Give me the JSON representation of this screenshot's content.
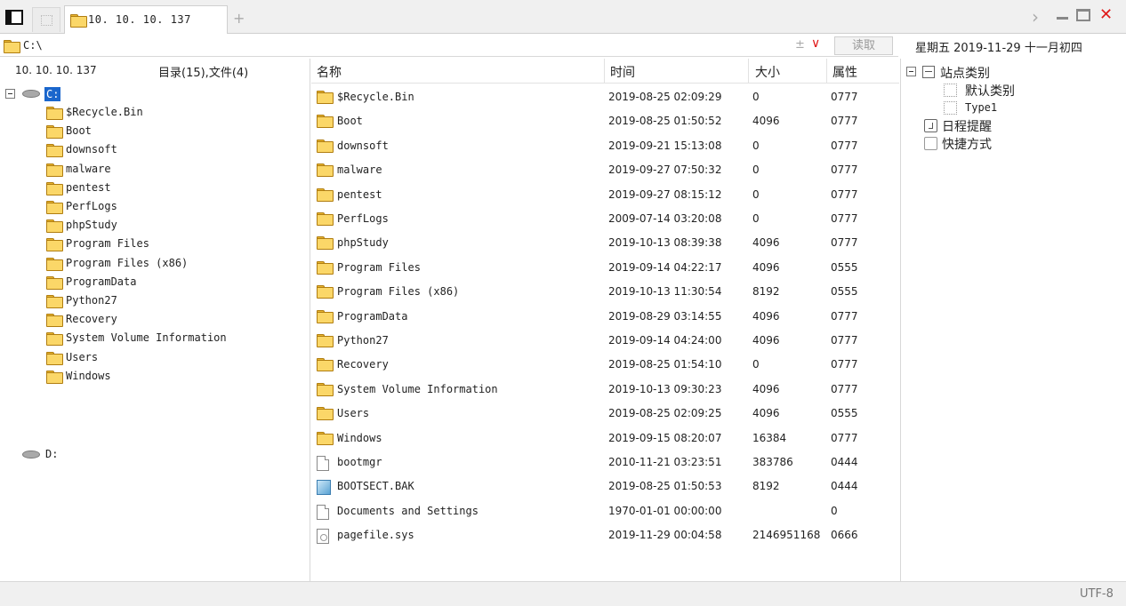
{
  "tabbar": {
    "tab_label": "10. 10. 10. 137",
    "add_glyph": "+",
    "next_glyph": "›",
    "close_glyph": "✕"
  },
  "address": {
    "path": "C:\\",
    "plusminus": "±",
    "dropdown": "∨",
    "read_button": "读取"
  },
  "date_text": "星期五 2019-11-29 十一月初四",
  "left": {
    "host": "10. 10. 10. 137",
    "summary": "目录(15),文件(4)",
    "root_label": "C:",
    "folders": [
      "$Recycle.Bin",
      "Boot",
      "downsoft",
      "malware",
      "pentest",
      "PerfLogs",
      "phpStudy",
      "Program Files",
      "Program Files (x86)",
      "ProgramData",
      "Python27",
      "Recovery",
      "System Volume Information",
      "Users",
      "Windows"
    ],
    "drive_d": "D:"
  },
  "table": {
    "headers": {
      "name": "名称",
      "time": "时间",
      "size": "大小",
      "attr": "属性"
    },
    "rows": [
      {
        "icon": "folder",
        "name": "$Recycle.Bin",
        "time": "2019-08-25 02:09:29",
        "size": "0",
        "attr": "0777"
      },
      {
        "icon": "folder",
        "name": "Boot",
        "time": "2019-08-25 01:50:52",
        "size": "4096",
        "attr": "0777"
      },
      {
        "icon": "folder",
        "name": "downsoft",
        "time": "2019-09-21 15:13:08",
        "size": "0",
        "attr": "0777"
      },
      {
        "icon": "folder",
        "name": "malware",
        "time": "2019-09-27 07:50:32",
        "size": "0",
        "attr": "0777"
      },
      {
        "icon": "folder",
        "name": "pentest",
        "time": "2019-09-27 08:15:12",
        "size": "0",
        "attr": "0777"
      },
      {
        "icon": "folder",
        "name": "PerfLogs",
        "time": "2009-07-14 03:20:08",
        "size": "0",
        "attr": "0777"
      },
      {
        "icon": "folder",
        "name": "phpStudy",
        "time": "2019-10-13 08:39:38",
        "size": "4096",
        "attr": "0777"
      },
      {
        "icon": "folder",
        "name": "Program Files",
        "time": "2019-09-14 04:22:17",
        "size": "4096",
        "attr": "0555"
      },
      {
        "icon": "folder",
        "name": "Program Files (x86)",
        "time": "2019-10-13 11:30:54",
        "size": "8192",
        "attr": "0555"
      },
      {
        "icon": "folder",
        "name": "ProgramData",
        "time": "2019-08-29 03:14:55",
        "size": "4096",
        "attr": "0777"
      },
      {
        "icon": "folder",
        "name": "Python27",
        "time": "2019-09-14 04:24:00",
        "size": "4096",
        "attr": "0777"
      },
      {
        "icon": "folder",
        "name": "Recovery",
        "time": "2019-08-25 01:54:10",
        "size": "0",
        "attr": "0777"
      },
      {
        "icon": "folder",
        "name": "System Volume Information",
        "time": "2019-10-13 09:30:23",
        "size": "4096",
        "attr": "0777"
      },
      {
        "icon": "folder",
        "name": "Users",
        "time": "2019-08-25 02:09:25",
        "size": "4096",
        "attr": "0555"
      },
      {
        "icon": "folder",
        "name": "Windows",
        "time": "2019-09-15 08:20:07",
        "size": "16384",
        "attr": "0777"
      },
      {
        "icon": "file",
        "name": "bootmgr",
        "time": "2010-11-21 03:23:51",
        "size": "383786",
        "attr": "0444"
      },
      {
        "icon": "bak",
        "name": "BOOTSECT.BAK",
        "time": "2019-08-25 01:50:53",
        "size": "8192",
        "attr": "0444"
      },
      {
        "icon": "file",
        "name": "Documents and Settings",
        "time": "1970-01-01 00:00:00",
        "size": "",
        "attr": "0"
      },
      {
        "icon": "sys",
        "name": "pagefile.sys",
        "time": "2019-11-29 00:04:58",
        "size": "2146951168",
        "attr": "0666"
      }
    ]
  },
  "right": {
    "category_title": "站点类别",
    "categories": [
      "默认类别",
      "Type1"
    ],
    "schedule": "日程提醒",
    "shortcuts": "快捷方式"
  },
  "status": {
    "encoding": "UTF-8"
  },
  "colors": {
    "accent_close": "#e01a1a",
    "selection": "#1a66cc",
    "folder": "#fbd768"
  }
}
